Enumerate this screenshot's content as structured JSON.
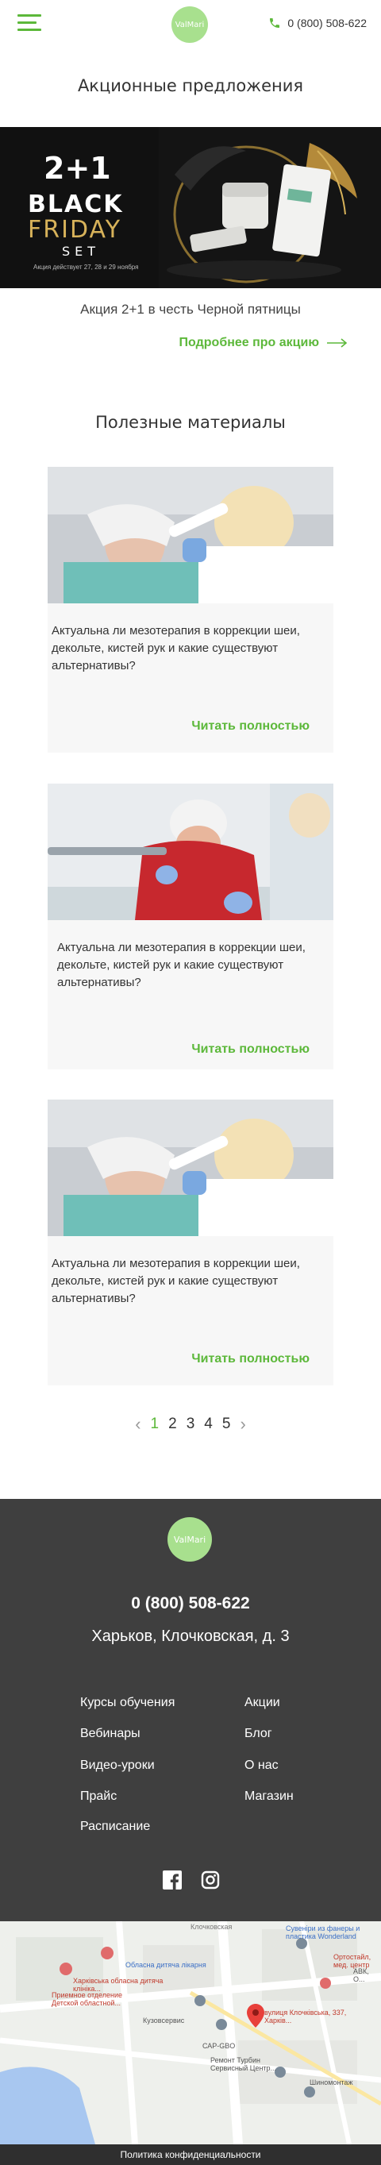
{
  "header": {
    "logo_text": "ValMari",
    "phone": "0 (800) 508-622"
  },
  "promo": {
    "title": "Акционные предложения",
    "banner": {
      "big": "2+1",
      "black": "BLACK",
      "friday": "FRIDAY",
      "set": "SET",
      "note": "Акция действует 27, 28 и 29 ноября"
    },
    "caption": "Акция 2+1 в честь Черной пятницы",
    "link": "Подробнее про акцию"
  },
  "materials": {
    "title": "Полезные материалы",
    "cards": [
      {
        "text": "Актуальна ли мезотерапия в коррекции шеи, декольте, кистей рук и какие существуют альтернативы?",
        "link": "Читать полностью"
      },
      {
        "text": "Актуальна ли мезотерапия в коррекции шеи, декольте, кистей рук и какие существуют альтернативы?",
        "link": "Читать полностью"
      },
      {
        "text": "Актуальна ли мезотерапия в коррекции шеи, декольте, кистей рук и какие существуют альтернативы?",
        "link": "Читать полностью"
      }
    ]
  },
  "pagination": {
    "pages": [
      "1",
      "2",
      "3",
      "4",
      "5"
    ],
    "active": "1",
    "prev": "‹",
    "next": "›"
  },
  "footer": {
    "logo_text": "ValMari",
    "phone": "0 (800) 508-622",
    "address": "Харьков, Клочковская, д. 3",
    "nav_left": [
      "Курсы обучения",
      "Вебинары",
      "Видео-уроки",
      "Прайс",
      "Расписание"
    ],
    "nav_right": [
      "Акции",
      "Блог",
      "О нас",
      "Магазин"
    ],
    "social": [
      "facebook-icon",
      "instagram-icon"
    ]
  },
  "map": {
    "labels": [
      "Обласна дитяча лікарня",
      "Сувеніри из фанеры и пластика Wonderland",
      "Ортостайл, мед. центр",
      "Харківська обласна дитяча клініка...",
      "Приемное отделение Детской областной...",
      "Кузовсервис",
      "вулиця Клочківська, 337, Харків...",
      "САР-GBO",
      "Ремонт Турбин Сервисный Центр...",
      "Шиномонтаж",
      "Клочковская",
      "АВК, О..."
    ]
  },
  "bottom_bar": {
    "privacy": "Политика конфиденциальности"
  },
  "colors": {
    "accent": "#5cb83a",
    "logo_bg": "#a8e08e",
    "footer_bg": "#3f3f3f"
  }
}
